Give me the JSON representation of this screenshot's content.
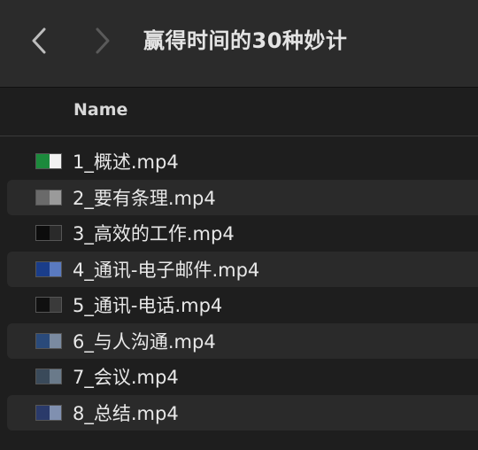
{
  "window": {
    "title": "赢得时间的30种妙计"
  },
  "toolbar": {
    "back_icon": "chevron-left-icon",
    "forward_icon": "chevron-right-icon"
  },
  "columns": {
    "name_label": "Name"
  },
  "files": [
    {
      "name": "1_概述.mp4",
      "thumb_colors": [
        "#1c8a3c",
        "#f2f2f2"
      ]
    },
    {
      "name": "2_要有条理.mp4",
      "thumb_colors": [
        "#6a6a6a",
        "#9a9a9a"
      ]
    },
    {
      "name": "3_高效的工作.mp4",
      "thumb_colors": [
        "#0c0c0c",
        "#2a2a2a"
      ]
    },
    {
      "name": "4_通讯-电子邮件.mp4",
      "thumb_colors": [
        "#1a3d8a",
        "#5a7ac0"
      ]
    },
    {
      "name": "5_通讯-电话.mp4",
      "thumb_colors": [
        "#101010",
        "#3a3a3a"
      ]
    },
    {
      "name": "6_与人沟通.mp4",
      "thumb_colors": [
        "#2a4a7a",
        "#7a8aa0"
      ]
    },
    {
      "name": "7_会议.mp4",
      "thumb_colors": [
        "#3a4a5a",
        "#6a7a8a"
      ]
    },
    {
      "name": "8_总结.mp4",
      "thumb_colors": [
        "#2a3a6a",
        "#8090b0"
      ]
    }
  ]
}
